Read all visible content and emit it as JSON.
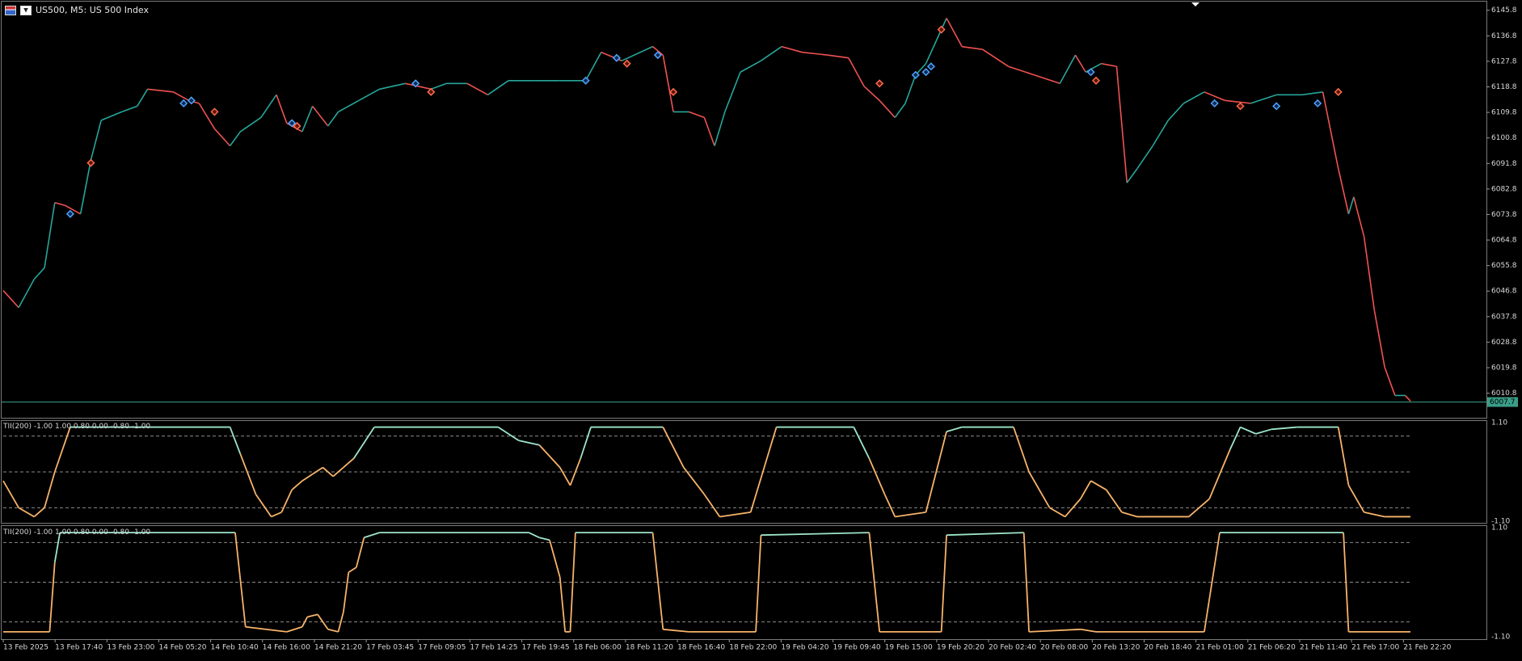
{
  "header": {
    "symbol_text": "US500, M5:  US 500 Index"
  },
  "icons": {
    "chart_menu": "chart-menu-icon",
    "one_click": "one-click-trading-icon"
  },
  "colors": {
    "background": "#000000",
    "bull": "#26a69a",
    "bear": "#ef5350",
    "grid_text": "#d8d8d8",
    "price_line": "#3a9d87",
    "tii_high": "#9ee6c9",
    "tii_low": "#f7b36a",
    "up_marker": "#4fa3ff",
    "down_marker": "#ff6a4d"
  },
  "price_axis_labels": [
    "6145.8",
    "6136.8",
    "6127.8",
    "6118.8",
    "6109.8",
    "6100.8",
    "6091.8",
    "6082.8",
    "6073.8",
    "6064.8",
    "6055.8",
    "6046.8",
    "6037.8",
    "6028.8",
    "6019.8",
    "6010.8"
  ],
  "current_price_label": "6007.7",
  "indicator_axis_labels": [
    "1.10",
    "-1.10"
  ],
  "time_axis_labels": [
    "13 Feb 2025",
    "13 Feb 17:40",
    "13 Feb 23:00",
    "14 Feb 05:20",
    "14 Feb 10:40",
    "14 Feb 16:00",
    "14 Feb 21:20",
    "17 Feb 03:45",
    "17 Feb 09:05",
    "17 Feb 14:25",
    "17 Feb 19:45",
    "18 Feb 06:00",
    "18 Feb 11:20",
    "18 Feb 16:40",
    "18 Feb 22:00",
    "19 Feb 04:20",
    "19 Feb 09:40",
    "19 Feb 15:00",
    "19 Feb 20:20",
    "20 Feb 02:40",
    "20 Feb 08:00",
    "20 Feb 13:20",
    "20 Feb 18:40",
    "21 Feb 01:00",
    "21 Feb 06:20",
    "21 Feb 11:40",
    "21 Feb 17:00",
    "21 Feb 22:20"
  ],
  "chart_data": [
    {
      "type": "line",
      "title": "US500, M5:  US 500 Index",
      "ylim": [
        6003,
        6148
      ],
      "x_range": [
        0,
        27.3
      ],
      "grid": false,
      "series": [
        {
          "values": [
            [
              0,
              6047
            ],
            [
              0.3,
              6041
            ],
            [
              0.6,
              6051
            ],
            [
              0.8,
              6055
            ],
            [
              1.0,
              6078
            ],
            [
              1.2,
              6077
            ],
            [
              1.5,
              6074
            ],
            [
              1.7,
              6093
            ],
            [
              1.9,
              6107
            ],
            [
              2.3,
              6110
            ],
            [
              2.6,
              6112
            ],
            [
              2.8,
              6118
            ],
            [
              3.3,
              6117
            ],
            [
              3.6,
              6114
            ],
            [
              3.8,
              6113
            ],
            [
              4.1,
              6104
            ],
            [
              4.4,
              6098
            ],
            [
              4.6,
              6103
            ],
            [
              5.0,
              6108
            ],
            [
              5.3,
              6116
            ],
            [
              5.5,
              6106
            ],
            [
              5.8,
              6103
            ],
            [
              6.0,
              6112
            ],
            [
              6.3,
              6105
            ],
            [
              6.5,
              6110
            ],
            [
              6.9,
              6114
            ],
            [
              7.3,
              6118
            ],
            [
              7.8,
              6120
            ],
            [
              8.3,
              6118
            ],
            [
              8.6,
              6120
            ],
            [
              9.0,
              6120
            ],
            [
              9.4,
              6116
            ],
            [
              9.8,
              6121
            ],
            [
              10.3,
              6121
            ],
            [
              10.8,
              6121
            ],
            [
              11.3,
              6121
            ],
            [
              11.6,
              6131
            ],
            [
              12.0,
              6128
            ],
            [
              12.6,
              6133
            ],
            [
              12.8,
              6130
            ],
            [
              13.0,
              6110
            ],
            [
              13.3,
              6110
            ],
            [
              13.6,
              6108
            ],
            [
              13.8,
              6098
            ],
            [
              14.0,
              6110
            ],
            [
              14.3,
              6124
            ],
            [
              14.7,
              6128
            ],
            [
              15.1,
              6133
            ],
            [
              15.5,
              6131
            ],
            [
              16.0,
              6130
            ],
            [
              16.4,
              6129
            ],
            [
              16.7,
              6119
            ],
            [
              17.0,
              6114
            ],
            [
              17.3,
              6108
            ],
            [
              17.5,
              6113
            ],
            [
              17.7,
              6123
            ],
            [
              17.9,
              6127
            ],
            [
              18.1,
              6135
            ],
            [
              18.3,
              6143
            ],
            [
              18.6,
              6133
            ],
            [
              19.0,
              6132
            ],
            [
              19.5,
              6126
            ],
            [
              20.0,
              6123
            ],
            [
              20.5,
              6120
            ],
            [
              20.8,
              6130
            ],
            [
              21.0,
              6124
            ],
            [
              21.3,
              6127
            ],
            [
              21.6,
              6126
            ],
            [
              21.8,
              6085
            ],
            [
              22.0,
              6090
            ],
            [
              22.3,
              6098
            ],
            [
              22.6,
              6107
            ],
            [
              22.9,
              6113
            ],
            [
              23.3,
              6117
            ],
            [
              23.7,
              6114
            ],
            [
              24.2,
              6113
            ],
            [
              24.7,
              6116
            ],
            [
              25.2,
              6116
            ],
            [
              25.6,
              6117
            ],
            [
              25.9,
              6090
            ],
            [
              26.1,
              6074
            ],
            [
              26.2,
              6080
            ],
            [
              26.4,
              6066
            ],
            [
              26.6,
              6040
            ],
            [
              26.8,
              6020
            ],
            [
              27.0,
              6010
            ],
            [
              27.2,
              6010
            ],
            [
              27.3,
              6008
            ]
          ]
        }
      ],
      "annotations": {
        "current_price": 6007.7,
        "buy_markers": [
          [
            1.3,
            6074
          ],
          [
            3.5,
            6113
          ],
          [
            3.65,
            6114
          ],
          [
            5.6,
            6106
          ],
          [
            8.0,
            6120
          ],
          [
            11.3,
            6121
          ],
          [
            11.9,
            6129
          ],
          [
            12.7,
            6130
          ],
          [
            17.7,
            6123
          ],
          [
            17.9,
            6124
          ],
          [
            18.0,
            6126
          ],
          [
            21.1,
            6124
          ],
          [
            23.5,
            6113
          ],
          [
            24.7,
            6112
          ],
          [
            25.5,
            6113
          ]
        ],
        "sell_markers": [
          [
            1.7,
            6092
          ],
          [
            4.1,
            6110
          ],
          [
            5.7,
            6105
          ],
          [
            8.3,
            6117
          ],
          [
            12.1,
            6127
          ],
          [
            13.0,
            6117
          ],
          [
            17.0,
            6120
          ],
          [
            18.2,
            6139
          ],
          [
            21.2,
            6121
          ],
          [
            24.0,
            6112
          ],
          [
            25.9,
            6117
          ]
        ]
      }
    },
    {
      "type": "line",
      "title": "TII(200) -1.00 1.00 0.80 0.00 -0.80 -1.00",
      "ylim": [
        -1.1,
        1.1
      ],
      "levels": [
        0.8,
        0.0,
        -0.8
      ],
      "series": [
        {
          "values": [
            [
              0,
              -0.2
            ],
            [
              0.3,
              -0.8
            ],
            [
              0.6,
              -1.0
            ],
            [
              0.8,
              -0.8
            ],
            [
              1.0,
              0.0
            ],
            [
              1.3,
              1.0
            ],
            [
              2.6,
              1.0
            ],
            [
              4.4,
              1.0
            ],
            [
              4.6,
              0.4
            ],
            [
              4.9,
              -0.5
            ],
            [
              5.2,
              -1.0
            ],
            [
              5.4,
              -0.9
            ],
            [
              5.6,
              -0.4
            ],
            [
              5.8,
              -0.2
            ],
            [
              6.0,
              -0.05
            ],
            [
              6.2,
              0.1
            ],
            [
              6.4,
              -0.1
            ],
            [
              6.6,
              0.1
            ],
            [
              6.8,
              0.3
            ],
            [
              7.2,
              1.0
            ],
            [
              9.6,
              1.0
            ],
            [
              10.0,
              0.7
            ],
            [
              10.4,
              0.6
            ],
            [
              10.8,
              0.1
            ],
            [
              11.0,
              -0.3
            ],
            [
              11.2,
              0.3
            ],
            [
              11.4,
              1.0
            ],
            [
              12.8,
              1.0
            ],
            [
              13.2,
              0.1
            ],
            [
              13.6,
              -0.5
            ],
            [
              13.9,
              -1.0
            ],
            [
              14.5,
              -0.9
            ],
            [
              15.0,
              1.0
            ],
            [
              16.5,
              1.0
            ],
            [
              16.8,
              0.3
            ],
            [
              17.1,
              -0.5
            ],
            [
              17.3,
              -1.0
            ],
            [
              17.9,
              -0.9
            ],
            [
              18.3,
              0.9
            ],
            [
              18.6,
              1.0
            ],
            [
              19.6,
              1.0
            ],
            [
              19.9,
              0.0
            ],
            [
              20.3,
              -0.8
            ],
            [
              20.6,
              -1.0
            ],
            [
              20.9,
              -0.6
            ],
            [
              21.1,
              -0.2
            ],
            [
              21.4,
              -0.4
            ],
            [
              21.7,
              -0.9
            ],
            [
              22.0,
              -1.0
            ],
            [
              23.0,
              -1.0
            ],
            [
              23.4,
              -0.6
            ],
            [
              23.8,
              0.5
            ],
            [
              24.0,
              1.0
            ],
            [
              24.3,
              0.85
            ],
            [
              24.6,
              0.95
            ],
            [
              25.1,
              1.0
            ],
            [
              25.9,
              1.0
            ],
            [
              26.1,
              -0.3
            ],
            [
              26.4,
              -0.9
            ],
            [
              26.8,
              -1.0
            ],
            [
              27.3,
              -1.0
            ]
          ]
        }
      ]
    },
    {
      "type": "line",
      "title": "TII(200) -1.00 1.00 0.80 0.00 -0.80 -1.00",
      "ylim": [
        -1.1,
        1.1
      ],
      "levels": [
        0.8,
        0.0,
        -0.8
      ],
      "series": [
        {
          "values": [
            [
              0,
              -1.0
            ],
            [
              0.9,
              -1.0
            ],
            [
              1.0,
              0.4
            ],
            [
              1.1,
              1.0
            ],
            [
              4.5,
              1.0
            ],
            [
              4.7,
              -0.9
            ],
            [
              5.5,
              -1.0
            ],
            [
              5.8,
              -0.9
            ],
            [
              5.9,
              -0.7
            ],
            [
              6.1,
              -0.65
            ],
            [
              6.3,
              -0.95
            ],
            [
              6.5,
              -1.0
            ],
            [
              6.6,
              -0.6
            ],
            [
              6.7,
              0.2
            ],
            [
              6.85,
              0.3
            ],
            [
              7.0,
              0.9
            ],
            [
              7.3,
              1.0
            ],
            [
              10.2,
              1.0
            ],
            [
              10.4,
              0.9
            ],
            [
              10.6,
              0.85
            ],
            [
              10.8,
              0.1
            ],
            [
              10.9,
              -1.0
            ],
            [
              11.0,
              -1.0
            ],
            [
              11.1,
              1.0
            ],
            [
              12.6,
              1.0
            ],
            [
              12.8,
              -0.95
            ],
            [
              13.3,
              -1.0
            ],
            [
              14.6,
              -1.0
            ],
            [
              14.7,
              0.95
            ],
            [
              16.8,
              1.0
            ],
            [
              17.0,
              -1.0
            ],
            [
              18.2,
              -1.0
            ],
            [
              18.3,
              0.95
            ],
            [
              19.8,
              1.0
            ],
            [
              19.9,
              -1.0
            ],
            [
              20.9,
              -0.95
            ],
            [
              21.2,
              -1.0
            ],
            [
              23.3,
              -1.0
            ],
            [
              23.6,
              1.0
            ],
            [
              26.0,
              1.0
            ],
            [
              26.1,
              -1.0
            ],
            [
              27.3,
              -1.0
            ]
          ]
        }
      ]
    }
  ]
}
